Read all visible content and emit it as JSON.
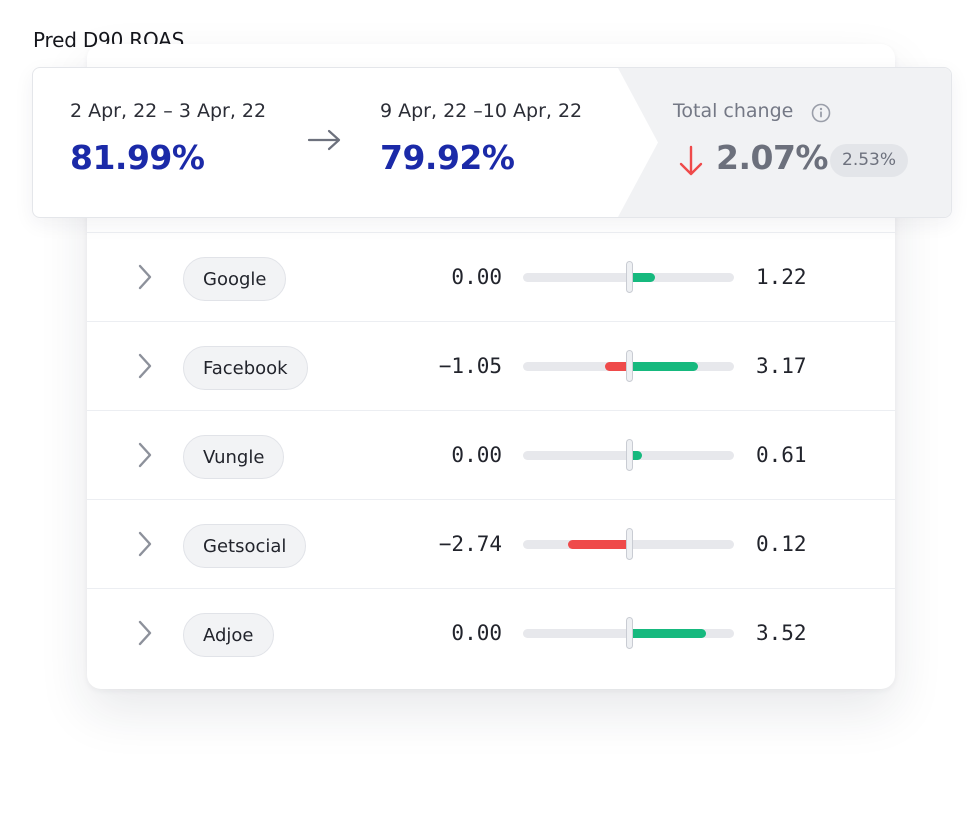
{
  "page": {
    "title": "Pred D90 ROAS"
  },
  "summary": {
    "period_a": {
      "label": "2 Apr, 22 – 3 Apr, 22",
      "value": "81.99%"
    },
    "period_b": {
      "label": "9 Apr, 22 –10 Apr, 22",
      "value": "79.92%"
    },
    "total": {
      "label": "Total change",
      "value": "2.07%",
      "badge": "2.53%",
      "direction": "down",
      "direction_color": "#ef4a4a"
    },
    "value_color": "#1b2aa8"
  },
  "colors": {
    "negative": "#ef4a4a",
    "positive": "#16b97e"
  },
  "rows": [
    {
      "name": "Google",
      "left_value": "0.00",
      "right_value": "1.22",
      "neg": 0.0,
      "pos": 1.22
    },
    {
      "name": "Facebook",
      "left_value": "−1.05",
      "right_value": "3.17",
      "neg": 1.05,
      "pos": 3.17
    },
    {
      "name": "Vungle",
      "left_value": "0.00",
      "right_value": "0.61",
      "neg": 0.0,
      "pos": 0.61
    },
    {
      "name": "Getsocial",
      "left_value": "−2.74",
      "right_value": "0.12",
      "neg": 2.74,
      "pos": 0.12
    },
    {
      "name": "Adjoe",
      "left_value": "0.00",
      "right_value": "3.52",
      "neg": 0.0,
      "pos": 3.52
    }
  ],
  "bar_scale_max": 4.8
}
